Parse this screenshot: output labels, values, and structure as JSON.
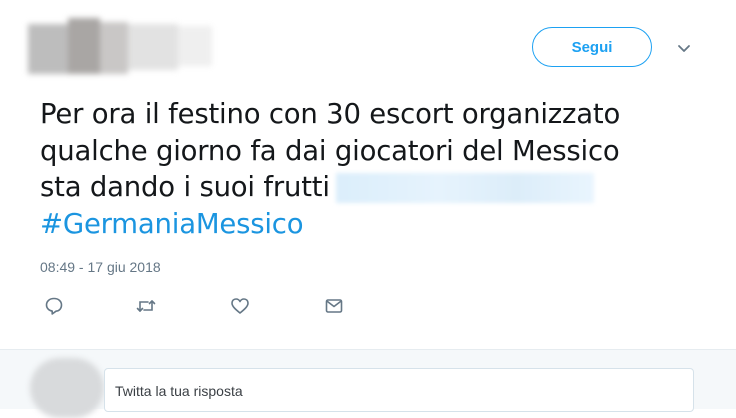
{
  "header": {
    "follow_label": "Segui",
    "more_icon": "chevron-down-icon"
  },
  "tweet": {
    "text_lines": [
      "Per ora il festino con 30 escort organizzato",
      "qualche giorno fa dai giocatori del Messico",
      "sta dando i suoi frutti"
    ],
    "hashtag": "#GermaniaMessico",
    "timestamp": "08:49 - 17 giu 2018"
  },
  "actions": [
    {
      "icon": "reply-icon"
    },
    {
      "icon": "retweet-icon"
    },
    {
      "icon": "like-icon"
    },
    {
      "icon": "direct-message-icon"
    }
  ],
  "reply": {
    "placeholder": "Twitta la tua risposta"
  },
  "colors": {
    "accent": "#1da1f2",
    "hashtag": "#1b95e0",
    "muted": "#657786",
    "text": "#14171a",
    "reply_bg": "#f5f8fa"
  }
}
